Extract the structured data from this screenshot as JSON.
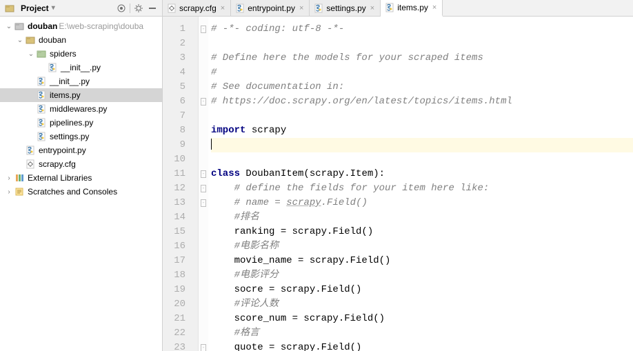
{
  "panel": {
    "title": "Project",
    "header_buttons": [
      "target-icon",
      "divider",
      "gear-icon",
      "collapse-icon"
    ]
  },
  "tree": [
    {
      "depth": 0,
      "arrow": "v",
      "icon": "folder-root",
      "label": "douban",
      "path": "E:\\web-scraping\\douba",
      "bold": true
    },
    {
      "depth": 1,
      "arrow": "v",
      "icon": "folder",
      "label": "douban"
    },
    {
      "depth": 2,
      "arrow": "v",
      "icon": "folder-pkg",
      "label": "spiders"
    },
    {
      "depth": 3,
      "arrow": "",
      "icon": "py",
      "label": "__init__.py"
    },
    {
      "depth": 2,
      "arrow": "",
      "icon": "py",
      "label": "__init__.py"
    },
    {
      "depth": 2,
      "arrow": "",
      "icon": "py",
      "label": "items.py",
      "selected": true
    },
    {
      "depth": 2,
      "arrow": "",
      "icon": "py",
      "label": "middlewares.py"
    },
    {
      "depth": 2,
      "arrow": "",
      "icon": "py",
      "label": "pipelines.py"
    },
    {
      "depth": 2,
      "arrow": "",
      "icon": "py",
      "label": "settings.py"
    },
    {
      "depth": 1,
      "arrow": "",
      "icon": "py",
      "label": "entrypoint.py"
    },
    {
      "depth": 1,
      "arrow": "",
      "icon": "cfg",
      "label": "scrapy.cfg"
    },
    {
      "depth": 0,
      "arrow": ">",
      "icon": "lib",
      "label": "External Libraries"
    },
    {
      "depth": 0,
      "arrow": ">",
      "icon": "scratch",
      "label": "Scratches and Consoles"
    }
  ],
  "tabs": [
    {
      "icon": "cfg",
      "label": "scrapy.cfg"
    },
    {
      "icon": "py",
      "label": "entrypoint.py"
    },
    {
      "icon": "py",
      "label": "settings.py"
    },
    {
      "icon": "py",
      "label": "items.py",
      "active": true
    }
  ],
  "code": {
    "lines": [
      {
        "n": 1,
        "fold": "-",
        "html": "<span class='cm'># -*- coding: utf-8 -*-</span>"
      },
      {
        "n": 2,
        "fold": "",
        "html": ""
      },
      {
        "n": 3,
        "fold": "",
        "html": "<span class='cm'># Define here the models for your scraped items</span>"
      },
      {
        "n": 4,
        "fold": "",
        "html": "<span class='cm'>#</span>"
      },
      {
        "n": 5,
        "fold": "",
        "html": "<span class='cm'># See documentation in:</span>"
      },
      {
        "n": 6,
        "fold": "-",
        "html": "<span class='cm'># https://doc.scrapy.org/en/latest/topics/items.html</span>"
      },
      {
        "n": 7,
        "fold": "",
        "html": ""
      },
      {
        "n": 8,
        "fold": "",
        "html": "<span class='kw'>import</span> scrapy"
      },
      {
        "n": 9,
        "fold": "",
        "html": "",
        "current": true
      },
      {
        "n": 10,
        "fold": "",
        "html": ""
      },
      {
        "n": 11,
        "fold": "-",
        "html": "<span class='kw'>class</span> DoubanItem(scrapy.Item):"
      },
      {
        "n": 12,
        "fold": "-",
        "html": "    <span class='cm'># define the fields for your item here like:</span>"
      },
      {
        "n": 13,
        "fold": "-",
        "html": "    <span class='cm'># name = <span class='underline'>scrapy</span>.Field()</span>"
      },
      {
        "n": 14,
        "fold": "",
        "html": "    <span class='cm'>#排名</span>"
      },
      {
        "n": 15,
        "fold": "",
        "html": "    ranking = scrapy.Field()"
      },
      {
        "n": 16,
        "fold": "",
        "html": "    <span class='cm'>#电影名称</span>"
      },
      {
        "n": 17,
        "fold": "",
        "html": "    movie_name = scrapy.Field()"
      },
      {
        "n": 18,
        "fold": "",
        "html": "    <span class='cm'>#电影评分</span>"
      },
      {
        "n": 19,
        "fold": "",
        "html": "    socre = scrapy.Field()"
      },
      {
        "n": 20,
        "fold": "",
        "html": "    <span class='cm'>#评论人数</span>"
      },
      {
        "n": 21,
        "fold": "",
        "html": "    score_num = scrapy.Field()"
      },
      {
        "n": 22,
        "fold": "",
        "html": "    <span class='cm'>#格言</span>"
      },
      {
        "n": 23,
        "fold": "-",
        "html": "    quote = scrapy.Field()"
      }
    ]
  }
}
